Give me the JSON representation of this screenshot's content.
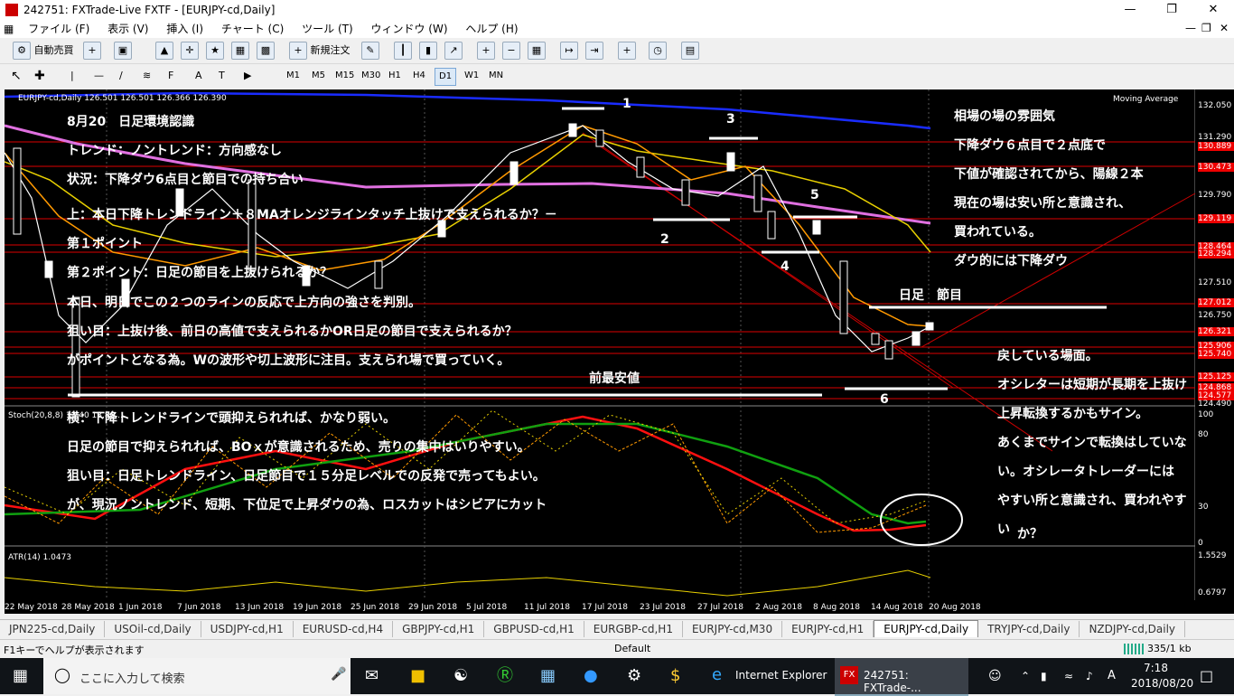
{
  "window": {
    "title": "242751: FXTrade-Live FXTF - [EURJPY-cd,Daily]"
  },
  "menu": [
    "ファイル (F)",
    "表示 (V)",
    "挿入 (I)",
    "チャート (C)",
    "ツール (T)",
    "ウィンドウ (W)",
    "ヘルプ (H)"
  ],
  "toolbar": {
    "auto_trade": "自動売買",
    "new_order": "新規注文"
  },
  "timeframes": [
    "M1",
    "M5",
    "M15",
    "M30",
    "H1",
    "H4",
    "D1",
    "W1",
    "MN"
  ],
  "timeframe_selected": "D1",
  "chart": {
    "header": "EURJPY-cd,Daily  126.501 126.501 126.366 126.390",
    "indicator_label": "Moving Average",
    "stoch_label": "Stoch(20,8,8) 13.40 13.80 ...",
    "atr_label": "ATR(14) 1.0473",
    "price_axis": [
      "132.050",
      "131.290",
      "129.790",
      "127.510",
      "126.750",
      "125.990",
      "125.230",
      "124.490",
      "100",
      "80",
      "30",
      "0",
      "1.5529",
      "0.6797"
    ],
    "price_tags": [
      "130.889",
      "130.473",
      "129.119",
      "128.464",
      "128.294",
      "127.012",
      "126.321",
      "125.906",
      "125.740",
      "125.125",
      "124.868",
      "124.577"
    ],
    "date_axis": [
      "22 May 2018",
      "28 May 2018",
      "1 Jun 2018",
      "7 Jun 2018",
      "13 Jun 2018",
      "19 Jun 2018",
      "25 Jun 2018",
      "29 Jun 2018",
      "5 Jul 2018",
      "11 Jul 2018",
      "17 Jul 2018",
      "23 Jul 2018",
      "27 Jul 2018",
      "2 Aug 2018",
      "8 Aug 2018",
      "14 Aug 2018",
      "20 Aug 2018"
    ]
  },
  "annotations": {
    "left": [
      "8月20　日足環境認識",
      "トレンド：ノントレンド：方向感なし",
      "状況：下降ダウ6点目と節目での持ち合い",
      "上：本日下降トレンドライン＋８MAオレンジラインタッチ上抜けで支えられるか？－",
      "第１ポイント",
      "第２ポイント：日足の節目を上抜けられるか？",
      "本日、明日でこの２つのラインの反応で上方向の強さを判別。",
      "狙い目：上抜け後、前日の高値で支えられるかOR日足の節目で支えられるか？",
      "がポイントとなる為。Wの波形や切上波形に注目。支えられ場で買っていく。",
      "横：下降トレンドラインで頭抑えられれば、かなり弱い。",
      "日足の節目で抑えられれば、BOｘが意識されるため、売りの集中はいりやすい。",
      "狙い目：日足トレンドライン、日足節目で１５分足レベルでの反発で売ってもよい。",
      "が、現況ノントレンド、短期、下位足で上昇ダウの為、ロスカットはシビアにカット"
    ],
    "right_top": [
      "相場の場の雰囲気",
      "下降ダウ６点目で２点底で",
      "下値が確認されてから、陽線２本",
      "現在の場は安い所と意識され、",
      "買われている。",
      "ダウ的には下降ダウ"
    ],
    "right_bottom": [
      "戻している場面。",
      "オシレターは短期が長期を上抜け",
      "上昇転換するかもサイン。",
      "あくまでサインで転換はしていな",
      "い。オシレータトレーダーには",
      "やすい所と意識され、買われやす",
      "い",
      "か？"
    ],
    "kijun": "日足　節目",
    "prev_low": "前最安値",
    "points": [
      "1",
      "2",
      "3",
      "4",
      "5",
      "6"
    ]
  },
  "tabs": [
    "JPN225-cd,Daily",
    "USOil-cd,Daily",
    "USDJPY-cd,H1",
    "EURUSD-cd,H4",
    "GBPJPY-cd,H1",
    "GBPUSD-cd,H1",
    "EURGBP-cd,H1",
    "EURJPY-cd,M30",
    "EURJPY-cd,H1",
    "EURJPY-cd,Daily",
    "TRYJPY-cd,Daily",
    "NZDJPY-cd,Daily"
  ],
  "active_tab": "EURJPY-cd,Daily",
  "status": {
    "help": "F1キーでヘルプが表示されます",
    "profile": "Default",
    "traffic": "335/1 kb"
  },
  "taskbar": {
    "search_placeholder": "ここに入力して検索",
    "ie_label": "Internet Explorer",
    "mt_label": "242751: FXTrade-...",
    "ime": "A",
    "time": "7:18",
    "date": "2018/08/20"
  }
}
